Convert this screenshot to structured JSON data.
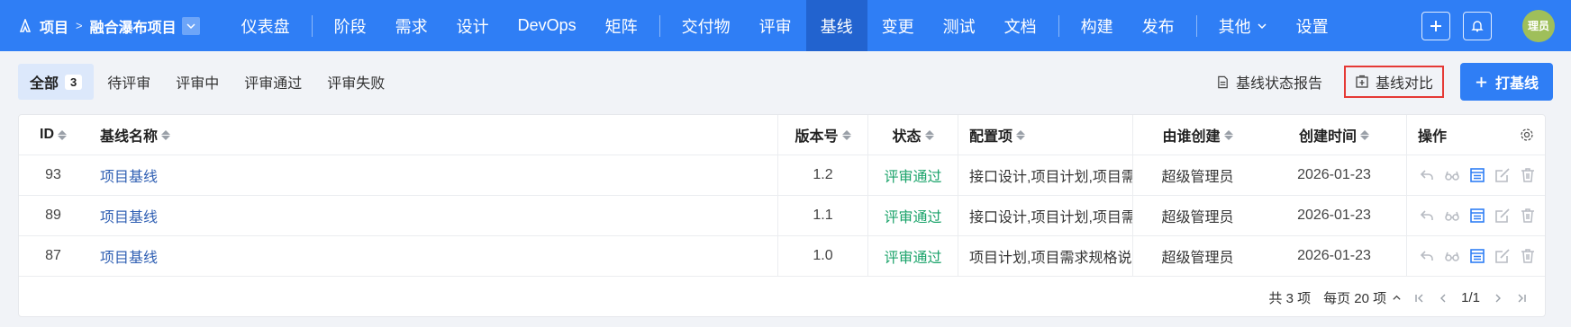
{
  "nav": {
    "crumb_root": "项目",
    "crumb_project": "融合瀑布项目",
    "items": [
      {
        "label": "仪表盘"
      },
      {
        "label": "阶段"
      },
      {
        "label": "需求"
      },
      {
        "label": "设计"
      },
      {
        "label": "DevOps"
      },
      {
        "label": "矩阵"
      },
      {
        "label": "交付物"
      },
      {
        "label": "评审"
      },
      {
        "label": "基线"
      },
      {
        "label": "变更"
      },
      {
        "label": "测试"
      },
      {
        "label": "文档"
      },
      {
        "label": "构建"
      },
      {
        "label": "发布"
      },
      {
        "label": "其他"
      },
      {
        "label": "设置"
      }
    ],
    "active": "基线",
    "avatar": "理员"
  },
  "filters": [
    {
      "label": "全部",
      "count": "3"
    },
    {
      "label": "待评审"
    },
    {
      "label": "评审中"
    },
    {
      "label": "评审通过"
    },
    {
      "label": "评审失败"
    }
  ],
  "toolbar": {
    "report_label": "基线状态报告",
    "compare_label": "基线对比",
    "create_label": "打基线"
  },
  "table": {
    "headers": {
      "id": "ID",
      "name": "基线名称",
      "version": "版本号",
      "status": "状态",
      "config": "配置项",
      "creator": "由谁创建",
      "time": "创建时间",
      "ops": "操作"
    },
    "rows": [
      {
        "id": "93",
        "name": "项目基线",
        "version": "1.2",
        "status": "评审通过",
        "config": "接口设计,项目计划,项目需",
        "creator": "超级管理员",
        "time": "2026-01-23"
      },
      {
        "id": "89",
        "name": "项目基线",
        "version": "1.1",
        "status": "评审通过",
        "config": "接口设计,项目计划,项目需",
        "creator": "超级管理员",
        "time": "2026-01-23"
      },
      {
        "id": "87",
        "name": "项目基线",
        "version": "1.0",
        "status": "评审通过",
        "config": "项目计划,项目需求规格说",
        "creator": "超级管理员",
        "time": "2026-01-23"
      }
    ]
  },
  "pager": {
    "total": "共 3 项",
    "per_page": "每页 20 项",
    "page": "1/1"
  },
  "colors": {
    "brand": "#2f7ef5",
    "success": "#1aa36a",
    "highlight": "#e53935"
  }
}
